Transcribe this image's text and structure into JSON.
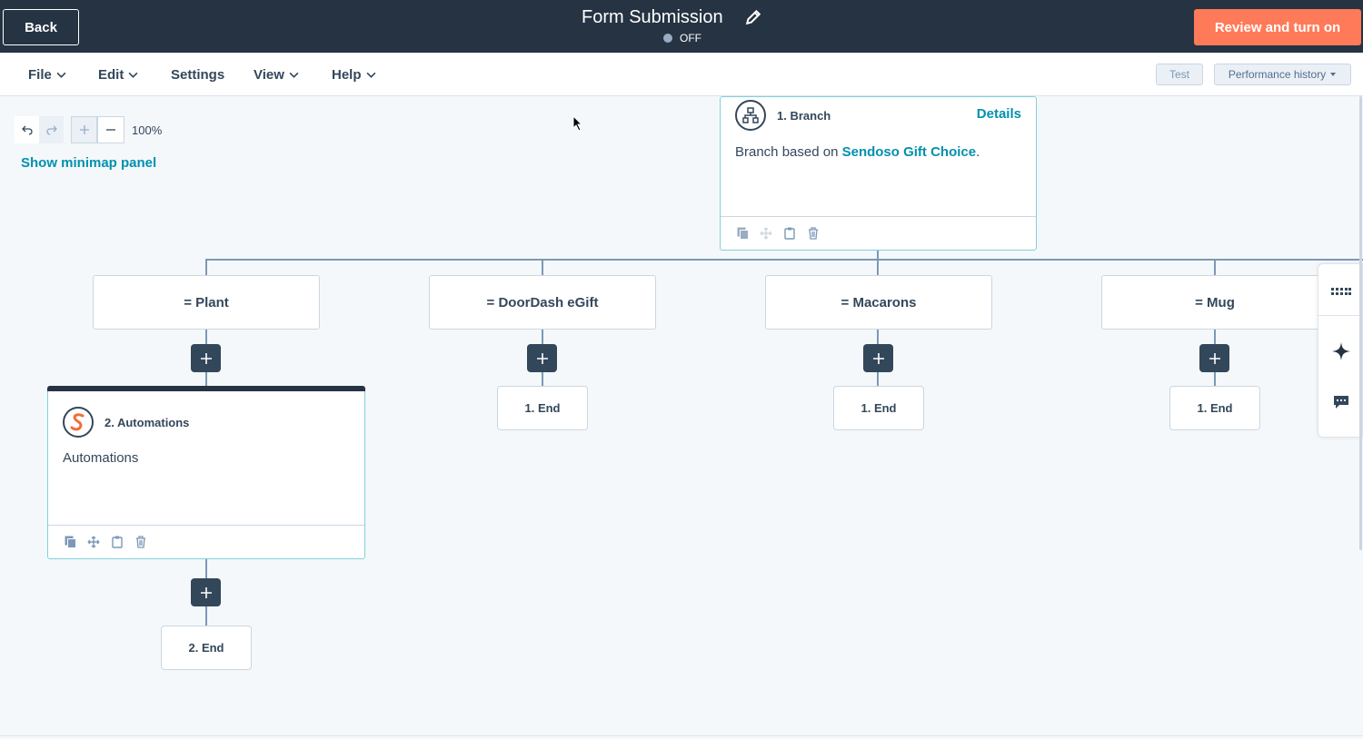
{
  "header": {
    "back_label": "Back",
    "title": "Form Submission",
    "status": "OFF",
    "review_label": "Review and turn on"
  },
  "menu": {
    "file": "File",
    "edit": "Edit",
    "settings": "Settings",
    "view": "View",
    "help": "Help",
    "test": "Test",
    "performance": "Performance history"
  },
  "canvas": {
    "zoom": "100%",
    "minimap": "Show minimap panel"
  },
  "branch_action": {
    "title": "1. Branch",
    "body_prefix": "Branch based on ",
    "property": "Sendoso Gift Choice",
    "body_suffix": ".",
    "details": "Details"
  },
  "branches": [
    {
      "label": "= Plant"
    },
    {
      "label": "= DoorDash eGift",
      "end": "1. End"
    },
    {
      "label": "= Macarons",
      "end": "1. End"
    },
    {
      "label": "= Mug",
      "end": "1. End"
    }
  ],
  "automation_action": {
    "title": "2. Automations",
    "body": "Automations",
    "end": "2. End"
  },
  "colors": {
    "topbar": "#253342",
    "accent": "#ff7a59",
    "link": "#0091ae"
  }
}
